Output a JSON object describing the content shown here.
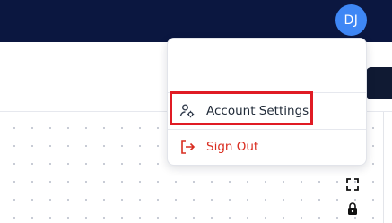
{
  "header": {
    "avatar_initials": "DJ"
  },
  "user_menu": {
    "items": [
      {
        "label": "Account Settings",
        "icon": "user-settings-icon"
      },
      {
        "label": "Sign Out",
        "icon": "sign-out-icon"
      }
    ],
    "highlighted_item": "Account Settings"
  },
  "canvas_controls": {
    "fit_view_icon": "expand-icon",
    "lock_icon": "lock-icon"
  },
  "colors": {
    "header_bg": "#0b1740",
    "avatar_bg": "#3e87f5",
    "sign_out": "#d92d20",
    "highlight_border": "#e01b24"
  }
}
